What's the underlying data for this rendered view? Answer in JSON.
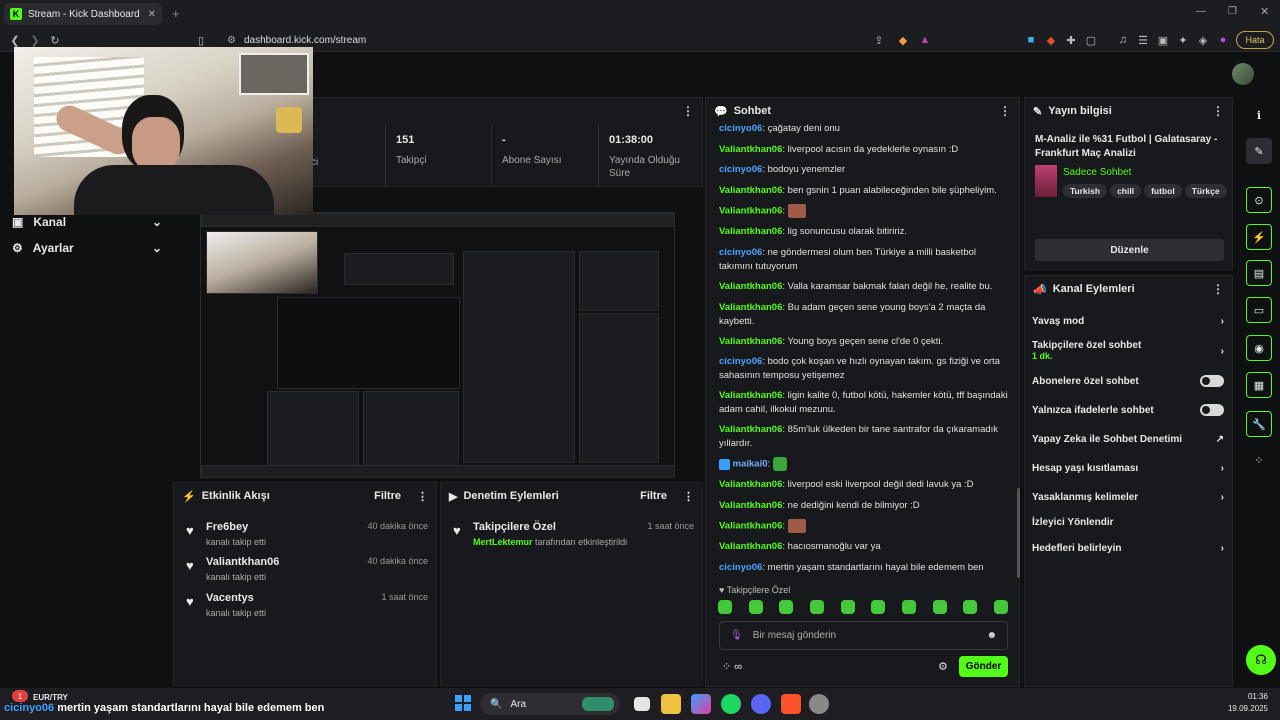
{
  "browser": {
    "tab_title": "Stream - Kick Dashboard",
    "url": "dashboard.kick.com/stream",
    "error_badge": "Hata"
  },
  "nav": {
    "channel": "Kanal",
    "settings": "Ayarlar"
  },
  "stats": {
    "viewers_partial": "ci",
    "followers_value": "151",
    "followers_label": "Takipçi",
    "subs_value": "-",
    "subs_label": "Abone Sayısı",
    "uptime_value": "01:38:00",
    "uptime_label": "Yayında Olduğu Süre"
  },
  "events": {
    "title": "Etkinlik Akışı",
    "filter": "Filtre",
    "items": [
      {
        "name": "Fre6bey",
        "sub": "kanalı takip etti",
        "time": "40 dakika önce"
      },
      {
        "name": "Valiantkhan06",
        "sub": "kanalı takip etti",
        "time": "40 dakika önce"
      },
      {
        "name": "Vacentys",
        "sub": "kanalı takip etti",
        "time": "1 saat önce"
      }
    ]
  },
  "moderation": {
    "title": "Denetim Eylemleri",
    "filter": "Filtre",
    "item_title": "Takipçilere Özel",
    "item_user": "MertLektemur",
    "item_suffix": "tarafından etkinleştirildi",
    "item_time": "1 saat önce"
  },
  "chat": {
    "title": "Sohbet",
    "messages": [
      {
        "user": "cicinyo06",
        "color": "b",
        "text": "çağatay deni onu"
      },
      {
        "user": "Valiantkhan06",
        "color": "g",
        "text": "liverpool acısın da yedeklerle oynasın :D"
      },
      {
        "user": "cicinyo06",
        "color": "b",
        "text": "bodoyu yenemzler"
      },
      {
        "user": "Valiantkhan06",
        "color": "g",
        "text": "ben gsnin 1 puan alabileceğinden bile şüpheliyim."
      },
      {
        "user": "Valiantkhan06",
        "color": "g",
        "text": ""
      },
      {
        "user": "Valiantkhan06",
        "color": "g",
        "text": "lig sonuncusu olarak bitiririz."
      },
      {
        "user": "cicinyo06",
        "color": "b",
        "text": "ne göndermesi olum ben Türkiye a milli basketbol takımını tutuyorum"
      },
      {
        "user": "Valiantkhan06",
        "color": "g",
        "text": "Valla karamsar bakmak falan değil he, realite bu."
      },
      {
        "user": "Valiantkhan06",
        "color": "g",
        "text": "Bu adam geçen sene young boys'a 2 maçta da kaybetti."
      },
      {
        "user": "Valiantkhan06",
        "color": "g",
        "text": "Young boys geçen sene cl'de 0 çekti."
      },
      {
        "user": "cicinyo06",
        "color": "b",
        "text": "bodo çok koşan ve hızlı oynayan takım. gs fiziği ve orta sahasının temposu yetişemez"
      },
      {
        "user": "Valiantkhan06",
        "color": "g",
        "text": "ligin kalite 0, futbol kötü, hakemler kötü, tff başındaki adam cahil, ilkokul mezunu."
      },
      {
        "user": "Valiantkhan06",
        "color": "g",
        "text": "85m'luk ülkeden bir tane santrafor da çıkaramadık yıllardır."
      },
      {
        "user": "maikai0",
        "color": "t",
        "text": ""
      },
      {
        "user": "Valiantkhan06",
        "color": "g",
        "text": "liverpool eski liverpool değil dedi lavuk ya :D"
      },
      {
        "user": "Valiantkhan06",
        "color": "g",
        "text": "ne dediğini kendi de bilmiyor :D"
      },
      {
        "user": "Valiantkhan06",
        "color": "g",
        "text": ""
      },
      {
        "user": "Valiantkhan06",
        "color": "g",
        "text": "hacıosmanoğlu var ya"
      },
      {
        "user": "cicinyo06",
        "color": "b",
        "text": "mertin yaşam standartlarını hayal bile edemem ben"
      }
    ],
    "mode_label": "Takipçilere Özel",
    "input_placeholder": "Bir mesaj gönderin",
    "send": "Gönder"
  },
  "stream_info": {
    "title": "Yayın bilgisi",
    "stream_title": "M-Analiz ile %31 Futbol | Galatasaray - Frankfurt Maç Analizi",
    "category": "Sadece Sohbet",
    "tags": [
      "Turkish",
      "chill",
      "futbol",
      "Türkçe"
    ],
    "edit": "Düzenle"
  },
  "channel_actions": {
    "title": "Kanal Eylemleri",
    "slow_mode": "Yavaş mod",
    "followers_only": "Takipçilere özel sohbet",
    "followers_only_sub": "1 dk.",
    "subs_only": "Abonelere özel sohbet",
    "emotes_only": "Yalnızca ifadelerle sohbet",
    "ai_moderation": "Yapay Zeka ile Sohbet Denetimi",
    "account_age": "Hesap yaşı kısıtlaması",
    "banned_words": "Yasaklanmış kelimeler",
    "redirect": "İzleyici Yönlendir",
    "goals": "Hedefleri belirleyin"
  },
  "taskbar": {
    "ticker": "EUR/TRY",
    "search": "Ara",
    "time": "01:36",
    "date": "19.09.2025",
    "caption_user": "cicinyo06",
    "caption_text": "mertin yaşam standartlarını hayal bile edemem ben"
  }
}
